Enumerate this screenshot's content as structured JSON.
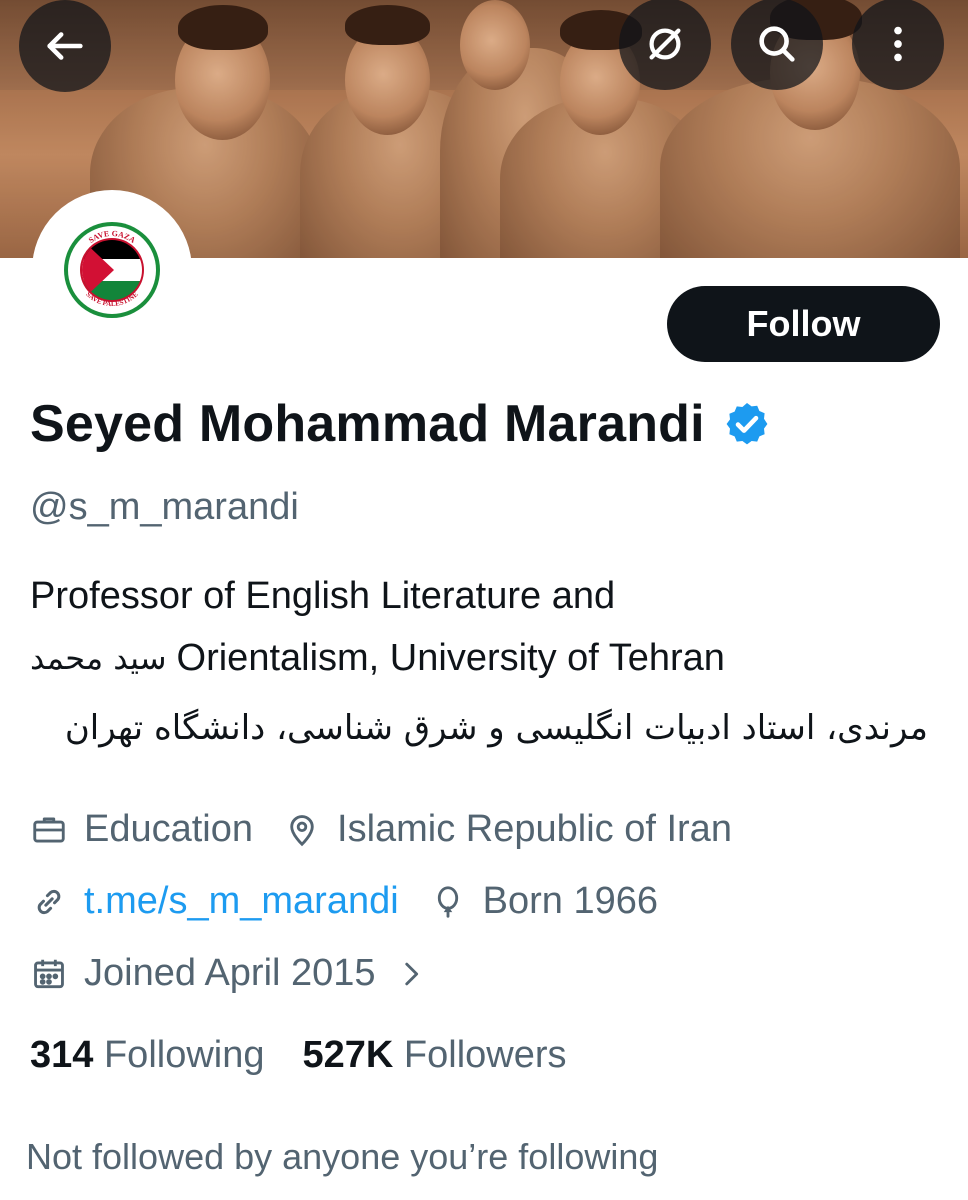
{
  "toolbar": {
    "back_icon": "arrow-left-icon",
    "mute_icon": "slashed-circle-icon",
    "search_icon": "search-icon",
    "more_icon": "more-vertical-icon"
  },
  "avatar": {
    "badge_text_top": "SAVE GAZA",
    "badge_text_bottom": "SAVE PALESTINE"
  },
  "profile": {
    "follow_label": "Follow",
    "name": "Seyed Mohammad Marandi",
    "handle": "@s_m_marandi",
    "bio_line1": "Professor of English Literature and",
    "bio_line2_fa": "سید محمد",
    "bio_line2_en": "Orientalism, University of Tehran",
    "bio_line3_fa": "مرندی، استاد ادبیات انگلیسی و شرق شناسی، دانشگاه تهران"
  },
  "meta": {
    "category": "Education",
    "location": "Islamic Republic of Iran",
    "link": "t.me/s_m_marandi",
    "born": "Born 1966",
    "joined": "Joined April 2015"
  },
  "stats": {
    "following_count": "314",
    "following_label": "Following",
    "followers_count": "527K",
    "followers_label": "Followers"
  },
  "footer": {
    "not_followed_text": "Not followed by anyone you’re following"
  },
  "colors": {
    "text": "#0f1419",
    "secondary": "#536471",
    "link": "#1d9bf0",
    "verified": "#1d9bf0"
  }
}
